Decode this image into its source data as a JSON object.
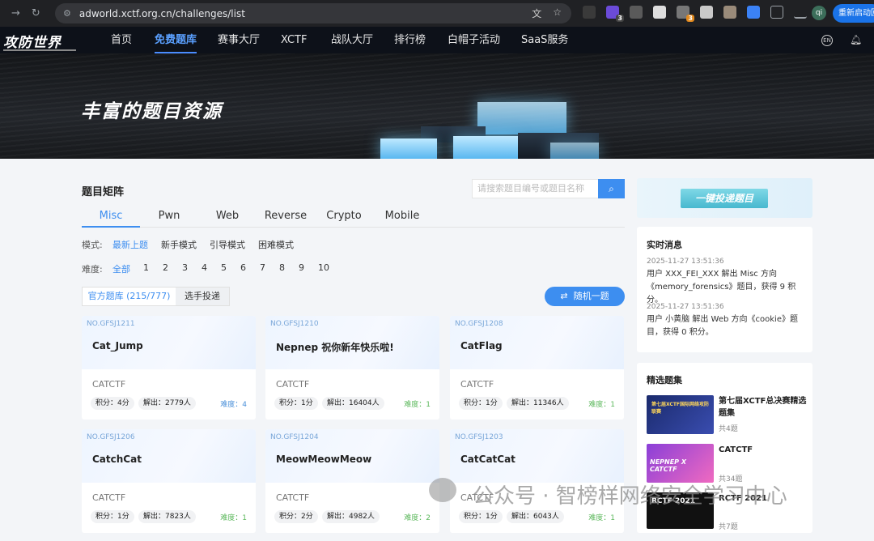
{
  "browser": {
    "url": "adworld.xctf.org.cn/challenges/list",
    "relaunch_label": "重新启动回",
    "profile_initial": "qi",
    "ext_badge_1": "3",
    "ext_badge_2": "3"
  },
  "sitenav": {
    "logo": "攻防世界",
    "items": [
      "首页",
      "免费题库",
      "赛事大厅",
      "XCTF",
      "战队大厅",
      "排行榜",
      "白帽子活动",
      "SaaS服务"
    ],
    "active_index": 1,
    "lang_label": "EN"
  },
  "banner": {
    "title": "丰富的题目资源"
  },
  "main": {
    "section_title": "题目矩阵",
    "search_placeholder": "请搜索题目编号或题目名称",
    "tabs": [
      "Misc",
      "Pwn",
      "Web",
      "Reverse",
      "Crypto",
      "Mobile"
    ],
    "mode_label": "模式:",
    "modes": [
      "最新上题",
      "新手模式",
      "引导模式",
      "困难模式"
    ],
    "difficulty_label": "难度:",
    "difficulties": [
      "全部",
      "1",
      "2",
      "3",
      "4",
      "5",
      "6",
      "7",
      "8",
      "9",
      "10"
    ],
    "source_official": "官方题库 (215/777)",
    "source_player": "选手投递",
    "random_label": "随机一题"
  },
  "cards": [
    {
      "no": "NO.GFSJ1211",
      "name": "Cat_Jump",
      "source": "CATCTF",
      "score": "积分：4分",
      "solved": "解出：2779人",
      "difficulty": "难度：4",
      "diff_color": "#4a90d9"
    },
    {
      "no": "NO.GFSJ1210",
      "name": "Nepnep 祝你新年快乐啦!",
      "source": "CATCTF",
      "score": "积分：1分",
      "solved": "解出：16404人",
      "difficulty": "难度：1",
      "diff_color": "#5cb85c"
    },
    {
      "no": "NO.GFSJ1208",
      "name": "CatFlag",
      "source": "CATCTF",
      "score": "积分：1分",
      "solved": "解出：11346人",
      "difficulty": "难度：1",
      "diff_color": "#5cb85c"
    },
    {
      "no": "NO.GFSJ1206",
      "name": "CatchCat",
      "source": "CATCTF",
      "score": "积分：1分",
      "solved": "解出：7823人",
      "difficulty": "难度：1",
      "diff_color": "#5cb85c"
    },
    {
      "no": "NO.GFSJ1204",
      "name": "MeowMeowMeow",
      "source": "CATCTF",
      "score": "积分：2分",
      "solved": "解出：4982人",
      "difficulty": "难度：2",
      "diff_color": "#5cb85c"
    },
    {
      "no": "NO.GFSJ1203",
      "name": "CatCatCat",
      "source": "CATCTF",
      "score": "积分：1分",
      "solved": "解出：6043人",
      "difficulty": "难度：1",
      "diff_color": "#5cb85c"
    }
  ],
  "sidebar": {
    "submit_label": "一键投递题目",
    "news_title": "实时消息",
    "news": [
      {
        "time": "2025-11-27 13:51:36",
        "msg": "用户 XXX_FEI_XXX 解出 Misc 方向《memory_forensics》题目，获得 9 积分。"
      },
      {
        "time": "2025-11-27 13:51:36",
        "msg": "用户 小黄脑 解出 Web 方向《cookie》题目，获得 0 积分。"
      }
    ],
    "featured_title": "精选题集",
    "featured": [
      {
        "name": "第七届XCTF总决赛精选题集",
        "count": "共4题",
        "thumb_text": "第七届XCTF国际网络攻防联赛"
      },
      {
        "name": "CATCTF",
        "count": "共34题",
        "thumb_text": "NEPNEP X CATCTF"
      },
      {
        "name": "RCTF 2021",
        "count": "共7题",
        "thumb_text": "RCTF 2021"
      }
    ]
  },
  "watermark": "公众号 · 智榜样网络安全学习中心"
}
